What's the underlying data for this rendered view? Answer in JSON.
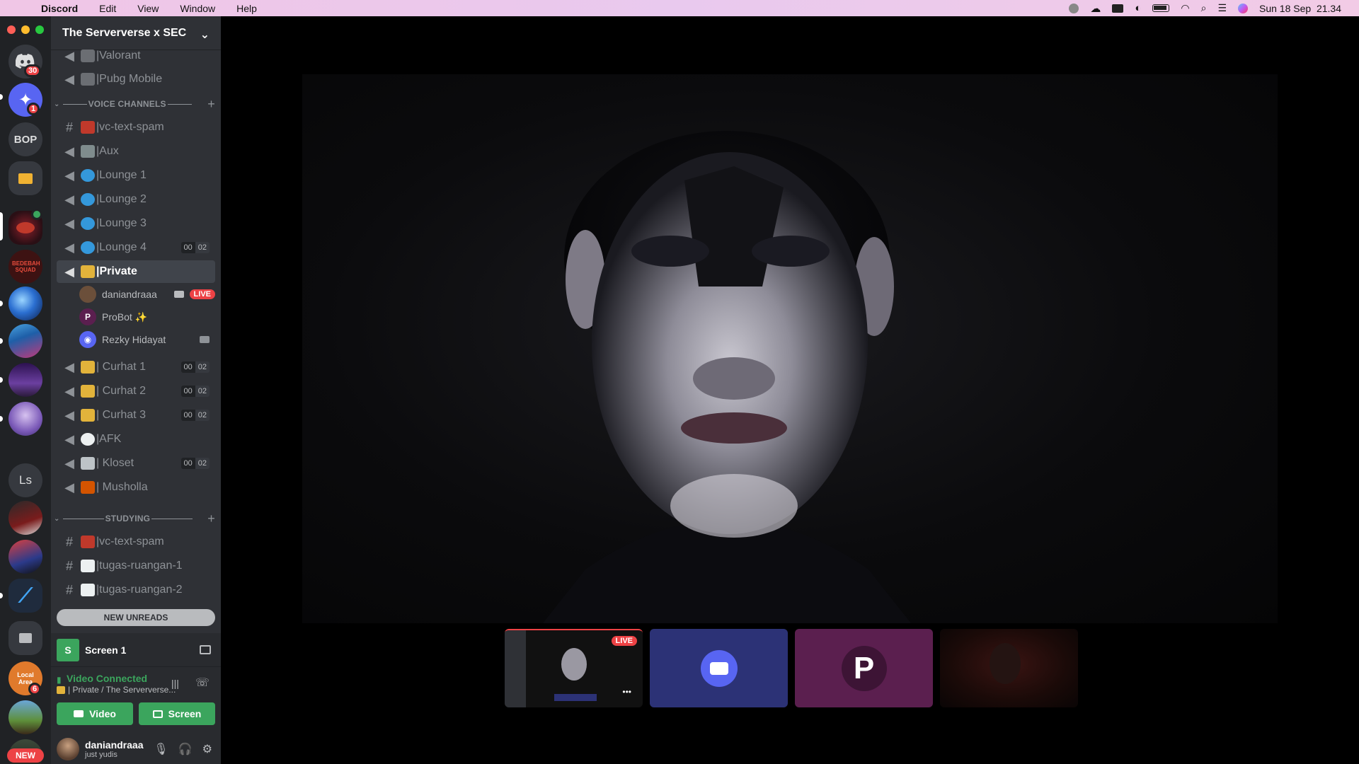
{
  "menubar": {
    "app": "Discord",
    "items": [
      "Edit",
      "View",
      "Window",
      "Help"
    ],
    "clock": "Sun 18 Sep  21.34"
  },
  "rail": {
    "dm_badge": "30",
    "server2_badge": "1",
    "bop_label": "BOP",
    "bedebah_label": "BEDEBAH SQUAD",
    "ls_label": "Ls",
    "local_area_label": "Local Area",
    "local_area_badge": "6",
    "new_badge": "NEW"
  },
  "guild": {
    "name": "The Serververse x SEC"
  },
  "channels_top": [
    {
      "label": "|Valorant",
      "emoji_color": "#8e9297"
    },
    {
      "label": "|Pubg Mobile",
      "emoji_color": "#8e9297"
    }
  ],
  "categories": {
    "voice": "VOICE CHANNELS",
    "studying": "STUDYING"
  },
  "voice_channels": [
    {
      "label": "|vc-text-spam",
      "type": "text",
      "emoji_color": "#c0392b"
    },
    {
      "label": "|Aux",
      "type": "voice",
      "emoji_color": "#7f8c8d"
    },
    {
      "label": "|Lounge 1",
      "type": "voice",
      "emoji_color": "#3498db"
    },
    {
      "label": "|Lounge 2",
      "type": "voice",
      "emoji_color": "#3498db"
    },
    {
      "label": "|Lounge 3",
      "type": "voice",
      "emoji_color": "#3498db"
    },
    {
      "label": "|Lounge 4",
      "type": "voice",
      "emoji_color": "#3498db",
      "counts": [
        "00",
        "02"
      ]
    },
    {
      "label": "|Private",
      "type": "voice",
      "emoji_color": "#e2b33b",
      "active": true
    },
    {
      "label": "| Curhat 1",
      "type": "voice",
      "emoji_color": "#e2b33b",
      "counts": [
        "00",
        "02"
      ]
    },
    {
      "label": "| Curhat 2",
      "type": "voice",
      "emoji_color": "#e2b33b",
      "counts": [
        "00",
        "02"
      ]
    },
    {
      "label": "| Curhat 3",
      "type": "voice",
      "emoji_color": "#e2b33b",
      "counts": [
        "00",
        "02"
      ]
    },
    {
      "label": "|AFK",
      "type": "voice",
      "emoji_color": "#ecf0f1"
    },
    {
      "label": "| Kloset",
      "type": "voice",
      "emoji_color": "#bdc3c7",
      "counts": [
        "00",
        "02"
      ]
    },
    {
      "label": "| Musholla",
      "type": "voice",
      "emoji_color": "#d35400"
    }
  ],
  "voice_users": [
    {
      "name": "daniandraaa",
      "live": "LIVE",
      "avatar_color": "#6b4f3a"
    },
    {
      "name": "ProBot ✨",
      "avatar_color": "#5b1f4f",
      "avatar_glyph": "P"
    },
    {
      "name": "Rezky Hidayat",
      "avatar_color": "#5865f2",
      "avatar_glyph": "◉"
    }
  ],
  "studying_channels": [
    {
      "label": "|vc-text-spam",
      "emoji_color": "#c0392b"
    },
    {
      "label": "|tugas-ruangan-1",
      "emoji_color": "#ecf0f1"
    },
    {
      "label": "|tugas-ruangan-2",
      "emoji_color": "#ecf0f1"
    }
  ],
  "new_unreads": "NEW UNREADS",
  "screen_panel": {
    "title": "Screen 1",
    "icon_letter": "S"
  },
  "rtc": {
    "status": "Video Connected",
    "location": "| Private / The Serververse...",
    "video_label": "Video",
    "screen_label": "Screen"
  },
  "user": {
    "name": "daniandraaa",
    "status": "just yudis"
  },
  "tiles": {
    "live_label": "LIVE",
    "more": "•••"
  },
  "colors": {
    "green": "#3ba55d",
    "red": "#ed4245",
    "blurple": "#5865f2",
    "probot": "#5b1f4f",
    "discord_tile": "#2c3276"
  }
}
